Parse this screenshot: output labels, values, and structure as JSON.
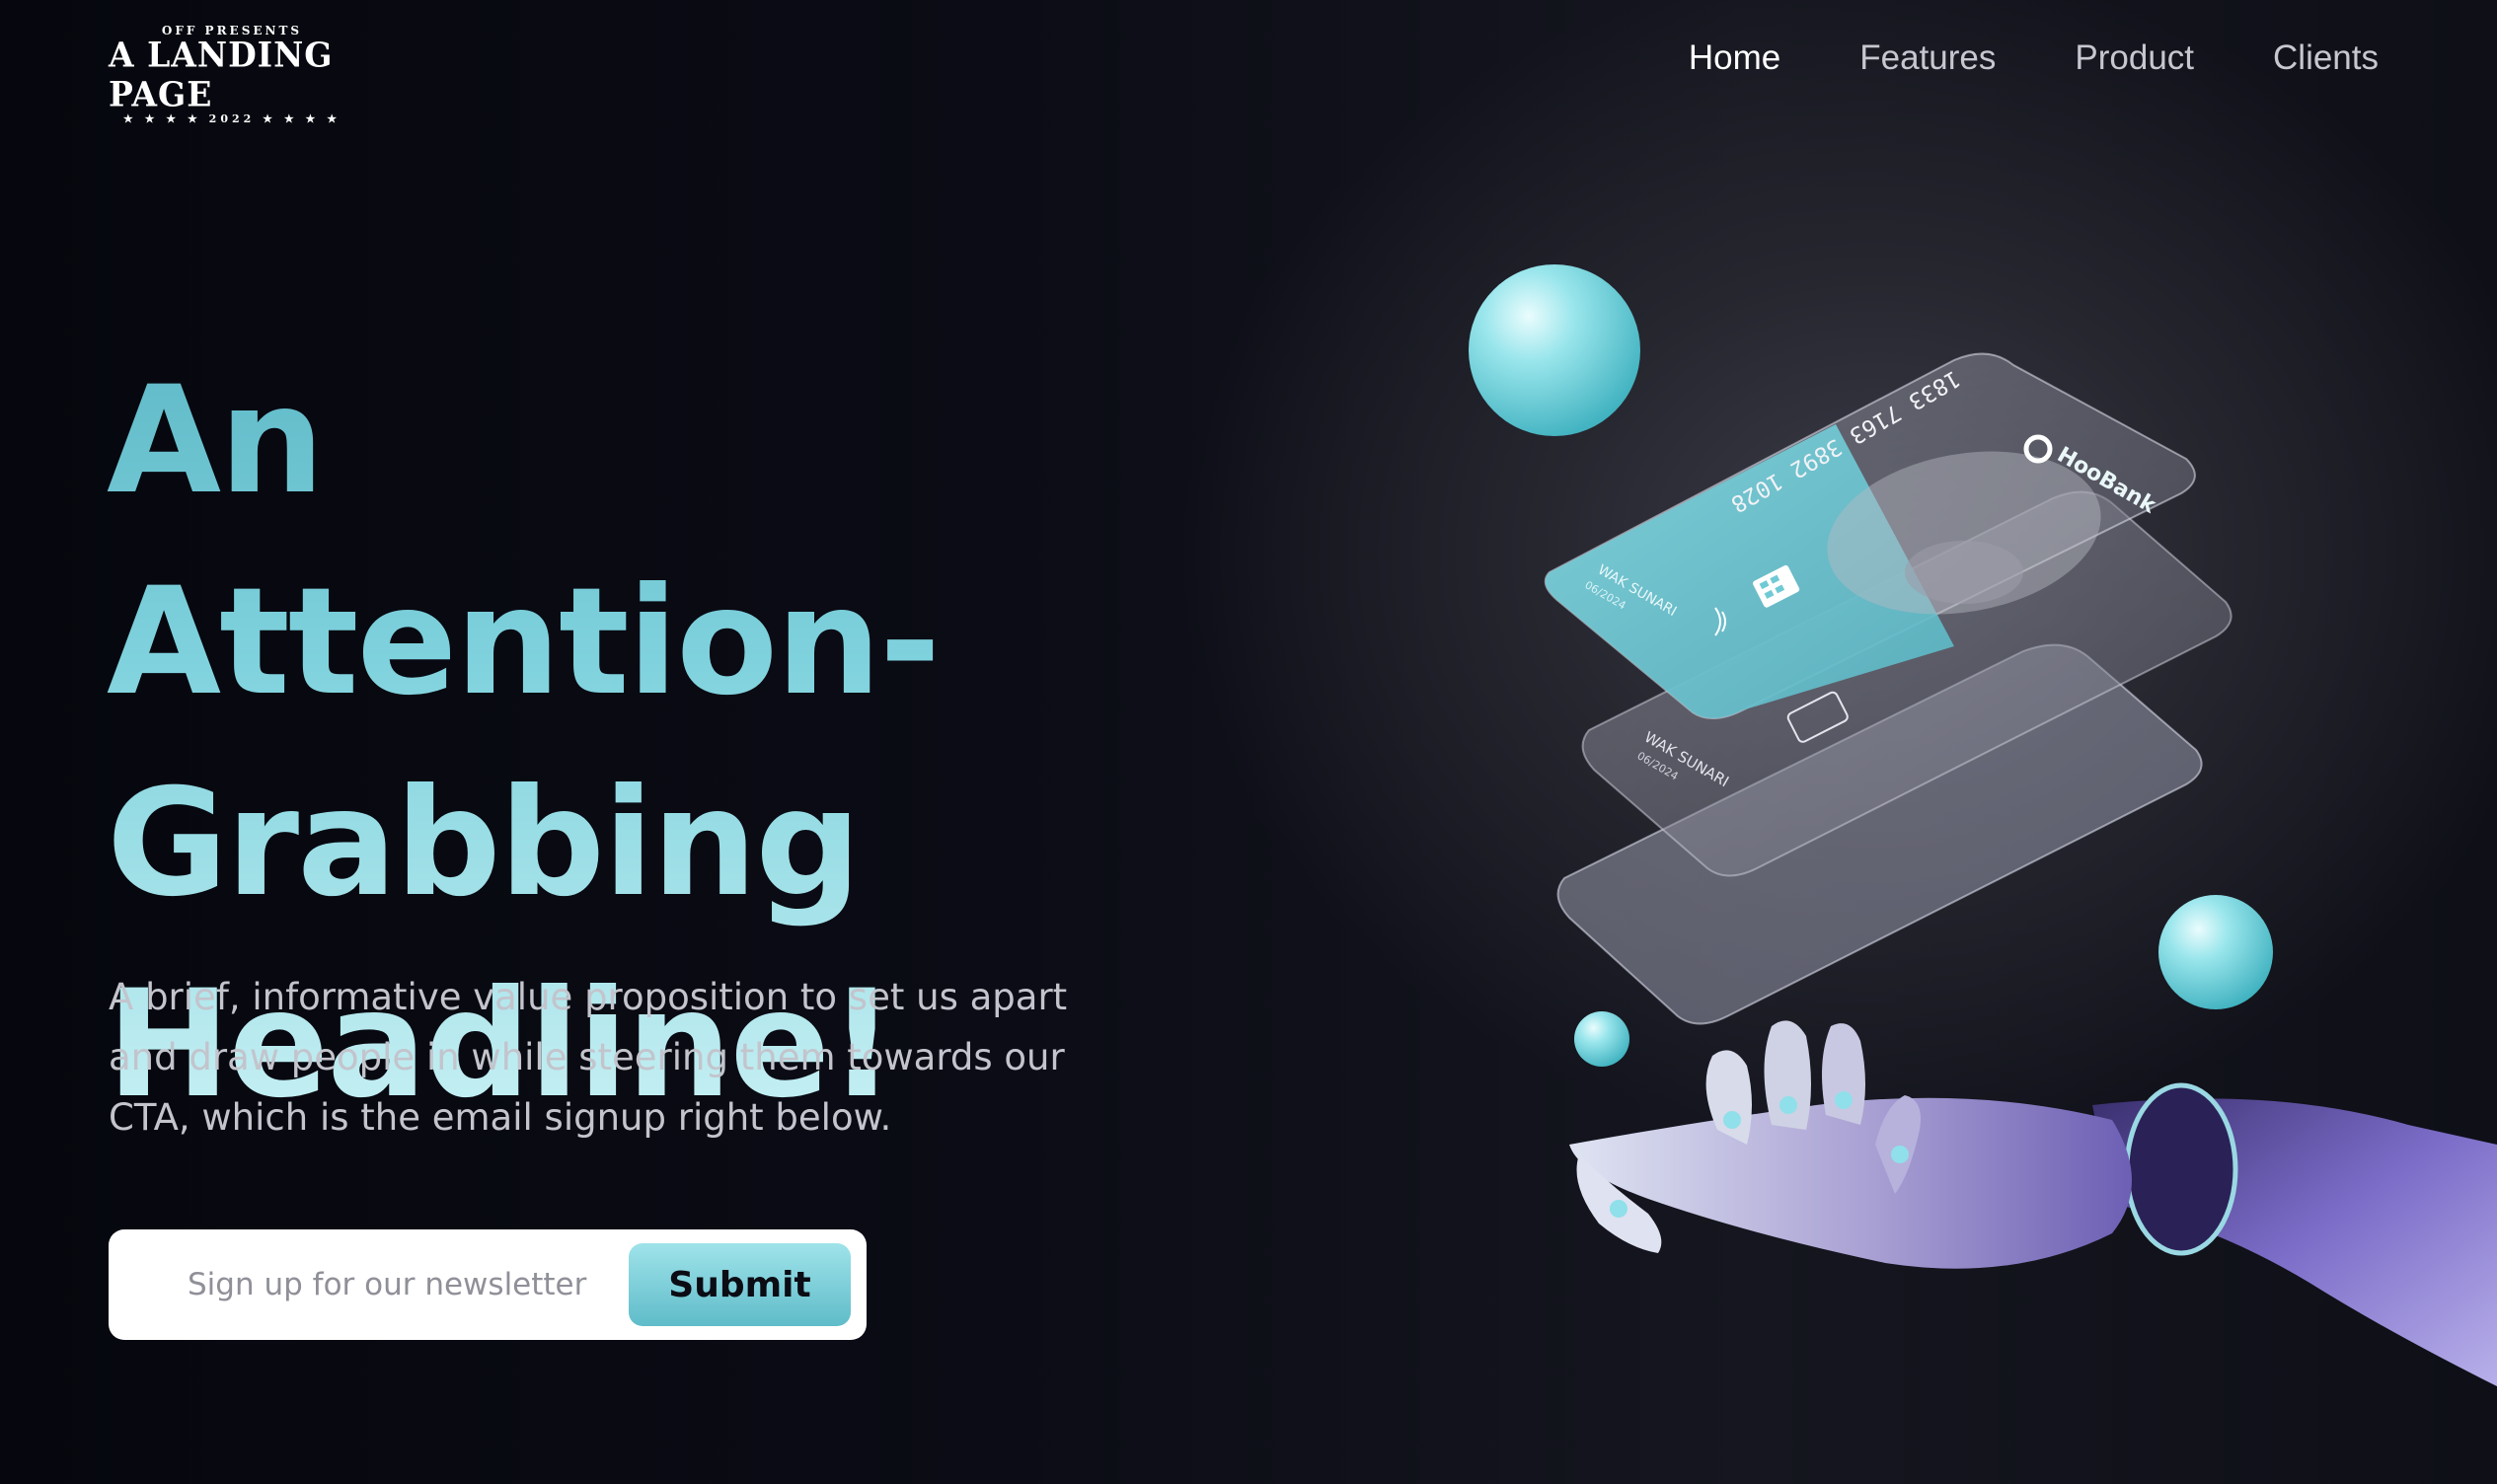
{
  "logo": {
    "top": "OFF PRESENTS",
    "main": "A LANDING PAGE",
    "bottom": "★ ★ ★ ★  2022  ★ ★ ★ ★"
  },
  "nav": {
    "items": [
      {
        "label": "Home",
        "active": true
      },
      {
        "label": "Features",
        "active": false
      },
      {
        "label": "Product",
        "active": false
      },
      {
        "label": "Clients",
        "active": false
      }
    ]
  },
  "hero": {
    "headline_lines": [
      "An Attention-",
      "Grabbing",
      "Headline!"
    ],
    "subtext": "A brief, informative value proposition to set us apart and draw people in while steering them towards our CTA, which is the email signup right below.",
    "signup": {
      "placeholder": "Sign up for our newsletter",
      "value": "",
      "button_label": "Submit"
    }
  },
  "illustration": {
    "card_number": "1833 7163 3892 1028",
    "card_brand": "HooBank",
    "card_holder": "WAK SUNARI",
    "card_expiry": "06/2024"
  },
  "colors": {
    "accent": "#7fd2dd",
    "accent_dark": "#5fbcc9",
    "background": "#07080f",
    "nav_text": "#c7c8cf",
    "body_text": "#c3c4cc"
  }
}
